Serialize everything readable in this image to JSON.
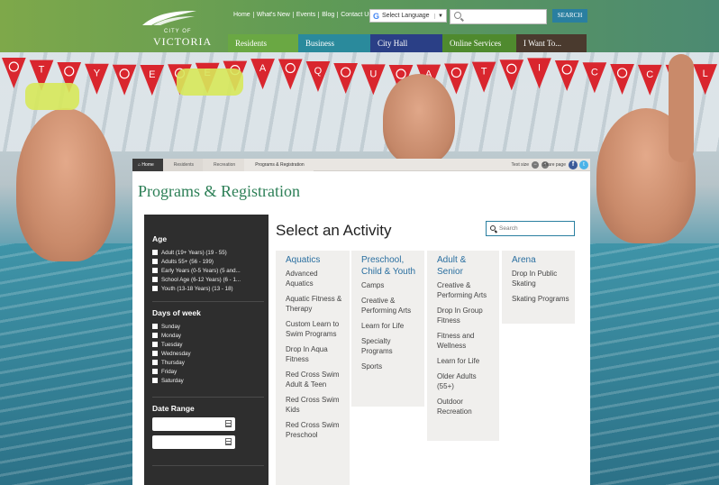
{
  "header": {
    "logo": {
      "line1": "CITY OF",
      "line2": "VICTORIA"
    },
    "top_links": [
      "Home",
      "What's New",
      "Events",
      "Blog",
      "Contact Us"
    ],
    "language_label": "Select Language",
    "search_button": "SEARCH",
    "nav": [
      "Residents",
      "Business",
      "City Hall",
      "Online Services",
      "I Want To..."
    ]
  },
  "breadcrumb": {
    "items": [
      "Home",
      "Residents",
      "Recreation",
      "Programs & Registration"
    ],
    "text_size_label": "Text size",
    "share_label": "Share page"
  },
  "page_title": "Programs & Registration",
  "filters": {
    "age": {
      "heading": "Age",
      "options": [
        "Adult (19+ Years) (19 - 55)",
        "Adults 55+ (56 - 199)",
        "Early Years (0-5 Years) (5 and...",
        "School Age (6-12 Years) (6 - 1...",
        "Youth (13-18 Years) (13 - 18)"
      ]
    },
    "days": {
      "heading": "Days of week",
      "options": [
        "Sunday",
        "Monday",
        "Tuesday",
        "Wednesday",
        "Thursday",
        "Friday",
        "Saturday"
      ]
    },
    "date_range": {
      "heading": "Date Range"
    }
  },
  "activity": {
    "title": "Select an Activity",
    "search_placeholder": "Search",
    "columns": [
      {
        "heading": "Aquatics",
        "items": [
          "Advanced Aquatics",
          "Aquatic Fitness & Therapy",
          "Custom Learn to Swim Programs",
          "Drop In Aqua Fitness",
          "Red Cross Swim Adult & Teen",
          "Red Cross Swim Kids",
          "Red Cross Swim Preschool"
        ]
      },
      {
        "heading": "Preschool, Child & Youth",
        "items": [
          "Camps",
          "Creative & Performing Arts",
          "Learn for Life",
          "Specialty Programs",
          "Sports"
        ]
      },
      {
        "heading": "Adult & Senior",
        "items": [
          "Creative & Performing Arts",
          "Drop In Group Fitness",
          "Fitness and Wellness",
          "Learn for Life",
          "Older Adults (55+)",
          "Outdoor Recreation"
        ]
      },
      {
        "heading": "Arena",
        "items": [
          "Drop In Public Skating",
          "Skating Programs"
        ]
      }
    ]
  },
  "banner_flags": "TYEE AQUATIC CLUB"
}
